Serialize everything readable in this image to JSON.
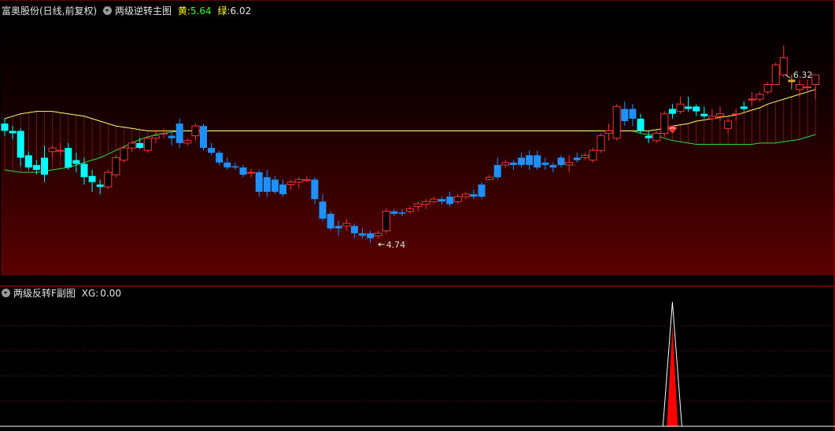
{
  "header": {
    "stock_name": "富奥股份(日线,前复权)",
    "main_indicator": "两级逆转主图",
    "yellow_label": "黄:",
    "yellow_value": "5.64",
    "green_label": "绿:",
    "green_value": "6.02"
  },
  "sub_header": {
    "indicator": "两级反转F副图",
    "xg_label": "XG:",
    "xg_value": "0.00"
  },
  "colors": {
    "up": "#ff3030",
    "down": "#1e90ff",
    "band_fill": "#ff4040",
    "yellow_line": "#ffff66",
    "green_line": "#33dd33",
    "cyan_candle": "#00ffff",
    "orange_candle": "#e0a040",
    "bg_gradient_bottom": "#5a0000",
    "spike": "#ff0000",
    "spike_outline": "#ffffff"
  },
  "chart_data": {
    "type": "candlestick",
    "y_axis_range": [
      4.5,
      6.5
    ],
    "annotations": [
      {
        "label": "6.32",
        "kind": "high_marker"
      },
      {
        "label": "4.74",
        "kind": "low_marker"
      }
    ],
    "candles_ohlc": [
      [
        5.68,
        5.72,
        5.58,
        5.62
      ],
      [
        5.62,
        5.66,
        5.55,
        5.6
      ],
      [
        5.62,
        5.64,
        5.33,
        5.4
      ],
      [
        5.42,
        5.45,
        5.3,
        5.32
      ],
      [
        5.34,
        5.38,
        5.26,
        5.3
      ],
      [
        5.4,
        5.5,
        5.2,
        5.26
      ],
      [
        5.45,
        5.5,
        5.4,
        5.48
      ],
      [
        5.46,
        5.52,
        5.42,
        5.46
      ],
      [
        5.48,
        5.52,
        5.3,
        5.32
      ],
      [
        5.38,
        5.44,
        5.28,
        5.35
      ],
      [
        5.35,
        5.4,
        5.18,
        5.24
      ],
      [
        5.25,
        5.3,
        5.12,
        5.2
      ],
      [
        5.18,
        5.22,
        5.1,
        5.16
      ],
      [
        5.16,
        5.3,
        5.14,
        5.28
      ],
      [
        5.26,
        5.42,
        5.24,
        5.4
      ],
      [
        5.38,
        5.5,
        5.36,
        5.48
      ],
      [
        5.48,
        5.54,
        5.45,
        5.52
      ],
      [
        5.52,
        5.56,
        5.47,
        5.48
      ],
      [
        5.46,
        5.58,
        5.44,
        5.56
      ],
      [
        5.56,
        5.62,
        5.52,
        5.58
      ],
      [
        5.6,
        5.64,
        5.56,
        5.6
      ],
      [
        5.58,
        5.62,
        5.5,
        5.56
      ],
      [
        5.68,
        5.72,
        5.48,
        5.52
      ],
      [
        5.52,
        5.56,
        5.5,
        5.54
      ],
      [
        5.58,
        5.68,
        5.54,
        5.66
      ],
      [
        5.66,
        5.68,
        5.46,
        5.48
      ],
      [
        5.48,
        5.52,
        5.42,
        5.44
      ],
      [
        5.44,
        5.46,
        5.34,
        5.36
      ],
      [
        5.36,
        5.4,
        5.3,
        5.32
      ],
      [
        5.33,
        5.36,
        5.3,
        5.32
      ],
      [
        5.32,
        5.34,
        5.24,
        5.26
      ],
      [
        5.28,
        5.31,
        5.24,
        5.28
      ],
      [
        5.28,
        5.3,
        5.08,
        5.12
      ],
      [
        5.24,
        5.3,
        5.08,
        5.12
      ],
      [
        5.22,
        5.25,
        5.1,
        5.12
      ],
      [
        5.18,
        5.22,
        5.08,
        5.1
      ],
      [
        5.18,
        5.22,
        5.14,
        5.2
      ],
      [
        5.2,
        5.24,
        5.15,
        5.22
      ],
      [
        5.22,
        5.25,
        5.2,
        5.22
      ],
      [
        5.22,
        5.24,
        5.02,
        5.06
      ],
      [
        5.04,
        5.1,
        4.88,
        4.9
      ],
      [
        4.94,
        4.96,
        4.8,
        4.82
      ],
      [
        4.84,
        4.88,
        4.76,
        4.82
      ],
      [
        4.84,
        4.9,
        4.8,
        4.86
      ],
      [
        4.84,
        4.86,
        4.74,
        4.78
      ],
      [
        4.78,
        4.82,
        4.74,
        4.76
      ],
      [
        4.78,
        4.8,
        4.7,
        4.74
      ],
      [
        4.76,
        4.8,
        4.74,
        4.78
      ],
      [
        4.8,
        4.98,
        4.78,
        4.96
      ],
      [
        4.96,
        4.98,
        4.92,
        4.94
      ],
      [
        4.95,
        4.98,
        4.92,
        4.94
      ],
      [
        4.96,
        5.0,
        4.94,
        4.98
      ],
      [
        5.0,
        5.04,
        4.96,
        5.02
      ],
      [
        5.02,
        5.06,
        4.98,
        5.04
      ],
      [
        5.04,
        5.08,
        5.02,
        5.06
      ],
      [
        5.06,
        5.08,
        5.02,
        5.04
      ],
      [
        5.08,
        5.12,
        5.0,
        5.02
      ],
      [
        5.04,
        5.1,
        5.02,
        5.08
      ],
      [
        5.08,
        5.12,
        5.06,
        5.1
      ],
      [
        5.1,
        5.14,
        5.06,
        5.08
      ],
      [
        5.18,
        5.2,
        5.06,
        5.08
      ],
      [
        5.22,
        5.26,
        5.22,
        5.24
      ],
      [
        5.34,
        5.4,
        5.22,
        5.24
      ],
      [
        5.34,
        5.38,
        5.32,
        5.36
      ],
      [
        5.36,
        5.38,
        5.3,
        5.34
      ],
      [
        5.4,
        5.44,
        5.32,
        5.34
      ],
      [
        5.42,
        5.46,
        5.3,
        5.34
      ],
      [
        5.42,
        5.46,
        5.3,
        5.32
      ],
      [
        5.36,
        5.4,
        5.3,
        5.34
      ],
      [
        5.34,
        5.36,
        5.28,
        5.32
      ],
      [
        5.4,
        5.42,
        5.32,
        5.34
      ],
      [
        5.34,
        5.42,
        5.28,
        5.36
      ],
      [
        5.4,
        5.44,
        5.36,
        5.38
      ],
      [
        5.4,
        5.44,
        5.38,
        5.42
      ],
      [
        5.38,
        5.48,
        5.36,
        5.46
      ],
      [
        5.46,
        5.6,
        5.44,
        5.58
      ],
      [
        5.6,
        5.68,
        5.54,
        5.62
      ],
      [
        5.56,
        5.84,
        5.54,
        5.82
      ],
      [
        5.8,
        5.86,
        5.66,
        5.7
      ],
      [
        5.8,
        5.84,
        5.66,
        5.72
      ],
      [
        5.72,
        5.76,
        5.6,
        5.62
      ],
      [
        5.58,
        5.62,
        5.52,
        5.56
      ],
      [
        5.54,
        5.62,
        5.52,
        5.6
      ],
      [
        5.6,
        5.78,
        5.58,
        5.76
      ],
      [
        5.8,
        5.84,
        5.72,
        5.76
      ],
      [
        5.78,
        5.9,
        5.76,
        5.84
      ],
      [
        5.82,
        5.9,
        5.78,
        5.8
      ],
      [
        5.82,
        5.84,
        5.74,
        5.78
      ],
      [
        5.76,
        5.82,
        5.72,
        5.74
      ],
      [
        5.72,
        5.8,
        5.7,
        5.74
      ],
      [
        5.74,
        5.82,
        5.7,
        5.76
      ],
      [
        5.64,
        5.72,
        5.6,
        5.7
      ],
      [
        5.76,
        5.8,
        5.7,
        5.76
      ],
      [
        5.82,
        5.86,
        5.78,
        5.8
      ],
      [
        5.88,
        5.94,
        5.82,
        5.88
      ],
      [
        5.88,
        5.94,
        5.86,
        5.92
      ],
      [
        5.94,
        6.02,
        5.92,
        6.0
      ],
      [
        6.0,
        6.18,
        6.0,
        6.16
      ],
      [
        6.08,
        6.32,
        6.06,
        6.22
      ],
      [
        6.02,
        6.08,
        5.96,
        6.04
      ],
      [
        5.96,
        6.04,
        5.9,
        6.0
      ],
      [
        5.98,
        6.04,
        5.94,
        5.98
      ],
      [
        6.0,
        6.02,
        5.88,
        6.08
      ]
    ],
    "yellow_line": [
      5.72,
      5.74,
      5.76,
      5.77,
      5.78,
      5.78,
      5.78,
      5.77,
      5.76,
      5.75,
      5.74,
      5.72,
      5.7,
      5.68,
      5.66,
      5.65,
      5.64,
      5.63,
      5.62,
      5.62,
      5.62,
      5.62,
      5.62,
      5.62,
      5.62,
      5.62,
      5.62,
      5.62,
      5.62,
      5.62,
      5.62,
      5.62,
      5.62,
      5.62,
      5.62,
      5.62,
      5.62,
      5.62,
      5.62,
      5.62,
      5.62,
      5.62,
      5.62,
      5.62,
      5.62,
      5.62,
      5.62,
      5.62,
      5.62,
      5.62,
      5.62,
      5.62,
      5.62,
      5.62,
      5.62,
      5.62,
      5.62,
      5.62,
      5.62,
      5.62,
      5.62,
      5.62,
      5.62,
      5.62,
      5.62,
      5.62,
      5.62,
      5.62,
      5.62,
      5.62,
      5.62,
      5.62,
      5.62,
      5.62,
      5.62,
      5.62,
      5.62,
      5.62,
      5.62,
      5.62,
      5.62,
      5.62,
      5.63,
      5.64,
      5.66,
      5.67,
      5.68,
      5.7,
      5.71,
      5.72,
      5.73,
      5.74,
      5.75,
      5.77,
      5.79,
      5.81,
      5.84,
      5.86,
      5.88,
      5.9,
      5.92,
      5.94,
      5.96
    ],
    "green_line": [
      5.3,
      5.29,
      5.28,
      5.28,
      5.28,
      5.29,
      5.3,
      5.31,
      5.32,
      5.34,
      5.36,
      5.38,
      5.4,
      5.43,
      5.46,
      5.49,
      5.52,
      5.55,
      5.57,
      5.59,
      5.6,
      5.61,
      5.62,
      5.62,
      5.62,
      5.62,
      5.62,
      5.62,
      5.62,
      5.62,
      5.62,
      5.62,
      5.62,
      5.62,
      5.62,
      5.62,
      5.62,
      5.62,
      5.62,
      5.62,
      5.62,
      5.62,
      5.62,
      5.62,
      5.62,
      5.62,
      5.62,
      5.62,
      5.62,
      5.62,
      5.62,
      5.62,
      5.62,
      5.62,
      5.62,
      5.62,
      5.62,
      5.62,
      5.62,
      5.62,
      5.62,
      5.62,
      5.62,
      5.62,
      5.62,
      5.62,
      5.62,
      5.62,
      5.62,
      5.62,
      5.62,
      5.62,
      5.62,
      5.62,
      5.62,
      5.62,
      5.62,
      5.62,
      5.62,
      5.62,
      5.6,
      5.59,
      5.58,
      5.56,
      5.54,
      5.53,
      5.52,
      5.51,
      5.51,
      5.51,
      5.51,
      5.51,
      5.51,
      5.51,
      5.51,
      5.52,
      5.52,
      5.52,
      5.53,
      5.54,
      5.55,
      5.57,
      5.59
    ],
    "signal_bar_index": 84,
    "sub_chart": {
      "type": "spike",
      "name": "XG",
      "spike_index": 84,
      "spike_value": 1,
      "y_range": [
        0,
        1
      ]
    }
  }
}
